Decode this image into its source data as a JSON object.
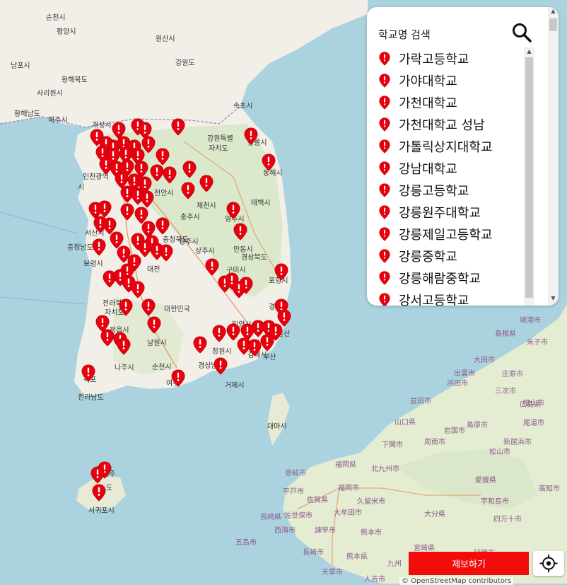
{
  "search": {
    "title": "학교명 검색",
    "schools": [
      "가락고등학교",
      "가야대학교",
      "가천대학교",
      "가천대학교 성남",
      "가톨릭상지대학교",
      "강남대학교",
      "강릉고등학교",
      "강릉원주대학교",
      "강릉제일고등학교",
      "강릉중학교",
      "강릉해람중학교",
      "강서고등학교"
    ]
  },
  "report_label": "제보하기",
  "attribution": "© OpenStreetMap contributors",
  "map_labels": {
    "kor": [
      "순천시",
      "평양시",
      "원산시",
      "강원도",
      "남포시",
      "황해북도",
      "사리원시",
      "황해남도",
      "해주시",
      "개성시",
      "속초시",
      "강원특별",
      "자치도",
      "강릉시",
      "인천광역",
      "시",
      "동해시",
      "제천시",
      "천안시",
      "태백시",
      "충주시",
      "영주시",
      "서산시",
      "충청남도",
      "보령시",
      "청주시",
      "충청북도",
      "상주시",
      "안동시",
      "대전",
      "경상북도",
      "구미시",
      "포항시",
      "전라북도",
      "자치도",
      "대한민국",
      "경주",
      "정읍시",
      "남원시",
      "밀양시",
      "울산",
      "나주시",
      "순천시",
      "창원시",
      "김해시",
      "부산",
      "목포",
      "여수",
      "전라남도",
      "경상남도",
      "거제시",
      "대마시",
      "서귀포시",
      "제주",
      "도"
    ],
    "jpn": [
      "境港市",
      "島根県",
      "米子市",
      "大田市",
      "出雲市",
      "庄原市",
      "浜田市",
      "三次市",
      "益田市",
      "広島県",
      "福山市",
      "山口県",
      "島原市",
      "尾道市",
      "下関市",
      "周南市",
      "岩国市",
      "新居浜市",
      "松山市",
      "北九州市",
      "福岡県",
      "愛媛県",
      "高知市",
      "壱岐市",
      "平戸市",
      "福岡市",
      "佐賀県",
      "久留米市",
      "宇和島市",
      "大分県",
      "長崎県",
      "佐世保市",
      "大牟田市",
      "西海市",
      "諫早市",
      "熊本市",
      "四万十市",
      "五島市",
      "長崎市",
      "熊本県",
      "宮崎県",
      "天草市",
      "九州",
      "人吉市",
      "延岡市"
    ]
  },
  "colors": {
    "marker": "#e8000f",
    "accent": "#f20c0c",
    "sea": "#aad3df",
    "land": "#f2efe9"
  },
  "icons": {
    "search": "search-icon",
    "pin": "map-pin-icon",
    "locate": "crosshair-icon"
  }
}
